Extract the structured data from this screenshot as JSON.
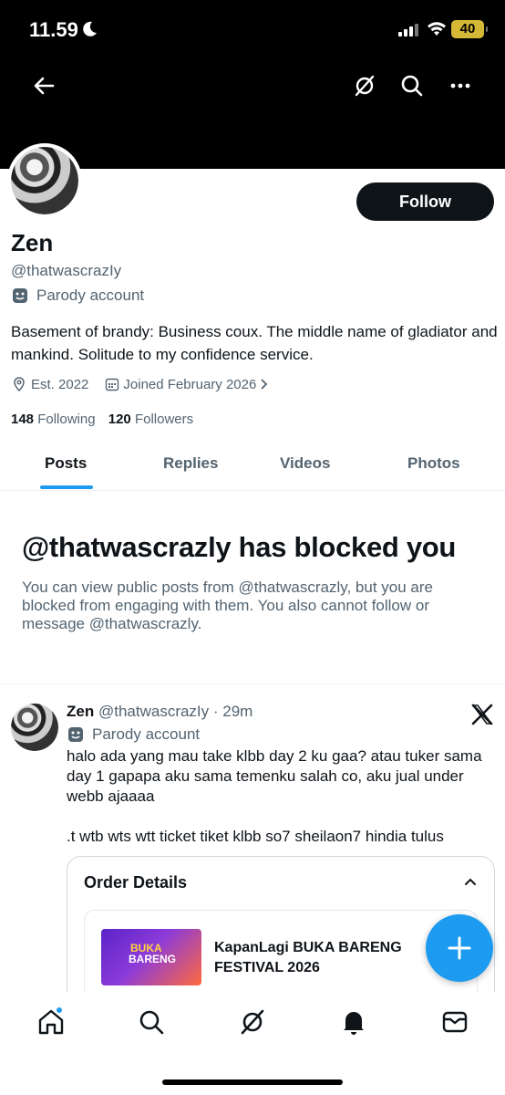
{
  "status_bar": {
    "time": "11.59",
    "battery": "40"
  },
  "profile": {
    "name": "Zen",
    "handle": "@thatwascrazIy",
    "parody_label": "Parody account",
    "follow_label": "Follow",
    "bio": "Basement of brandy: Business coux. The middle name of gladiator and mankind. Solitude to my confidence service.",
    "location": "Est. 2022",
    "joined": "Joined February 2026",
    "following_count": "148",
    "following_label": "Following",
    "followers_count": "120",
    "followers_label": "Followers"
  },
  "tabs": [
    {
      "label": "Posts"
    },
    {
      "label": "Replies"
    },
    {
      "label": "Videos"
    },
    {
      "label": "Photos"
    }
  ],
  "blocked": {
    "title": "@thatwascrazly has blocked you",
    "text": "You can view public posts from @thatwascrazly, but you are blocked from engaging with them. You also cannot follow or message @thatwascrazly."
  },
  "post": {
    "author": "Zen",
    "handle_time": "@thatwascrazIy · 29m",
    "parody_label": "Parody account",
    "text": "halo ada yang mau take klbb day 2 ku gaa? atau tuker sama day 1 gapapa aku sama temenku salah co, aku jual under webb ajaaaa\n\n.t wtb wts wtt ticket tiket klbb so7 sheilaon7 hindia tulus",
    "card_title": "Order Details",
    "event_name": "KapanLagi BUKA BARENG FESTIVAL 2026",
    "event_logo_top": "BUKA",
    "event_logo_bottom": "BARENG"
  },
  "bottom_nav": [
    "home-icon",
    "search-icon",
    "grok-icon",
    "notifications-icon",
    "messages-icon"
  ]
}
